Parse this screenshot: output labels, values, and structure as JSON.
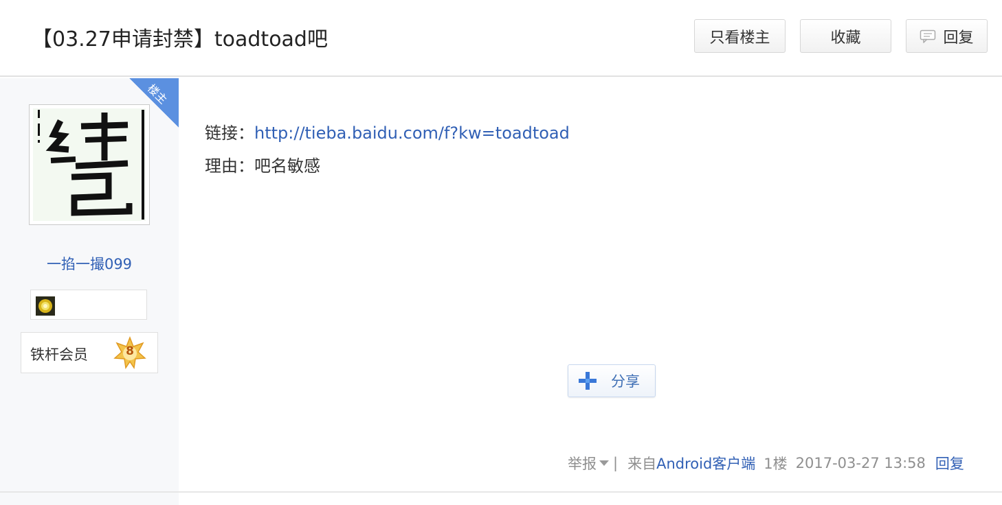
{
  "header": {
    "title": "【03.27申请封禁】toadtoad吧",
    "only_op_label": "只看楼主",
    "favorite_label": "收藏",
    "reply_label": "回复"
  },
  "author": {
    "op_ribbon": "楼主",
    "username": "一掐一撮099",
    "member_label": "铁杆会员",
    "level": "8"
  },
  "post": {
    "link_label": "链接：",
    "link_url": "http://tieba.baidu.com/f?kw=toadtoad",
    "reason_label": "理由：",
    "reason_text": "吧名敏感",
    "share_label": "分享"
  },
  "footer": {
    "report_label": "举报",
    "separator": "|",
    "from_prefix": "来自",
    "client_link": "Android客户端",
    "floor": "1楼",
    "timestamp": "2017-03-27 13:58",
    "reply_link": "回复"
  },
  "colors": {
    "link": "#3160b5",
    "ribbon": "#5b90e0",
    "sidebar_bg": "#f7f8fa"
  },
  "icons": [
    "reply-bubble-icon",
    "user-avatar",
    "badge-icon",
    "level-star-icon",
    "share-plus-icon",
    "caret-down-icon"
  ]
}
